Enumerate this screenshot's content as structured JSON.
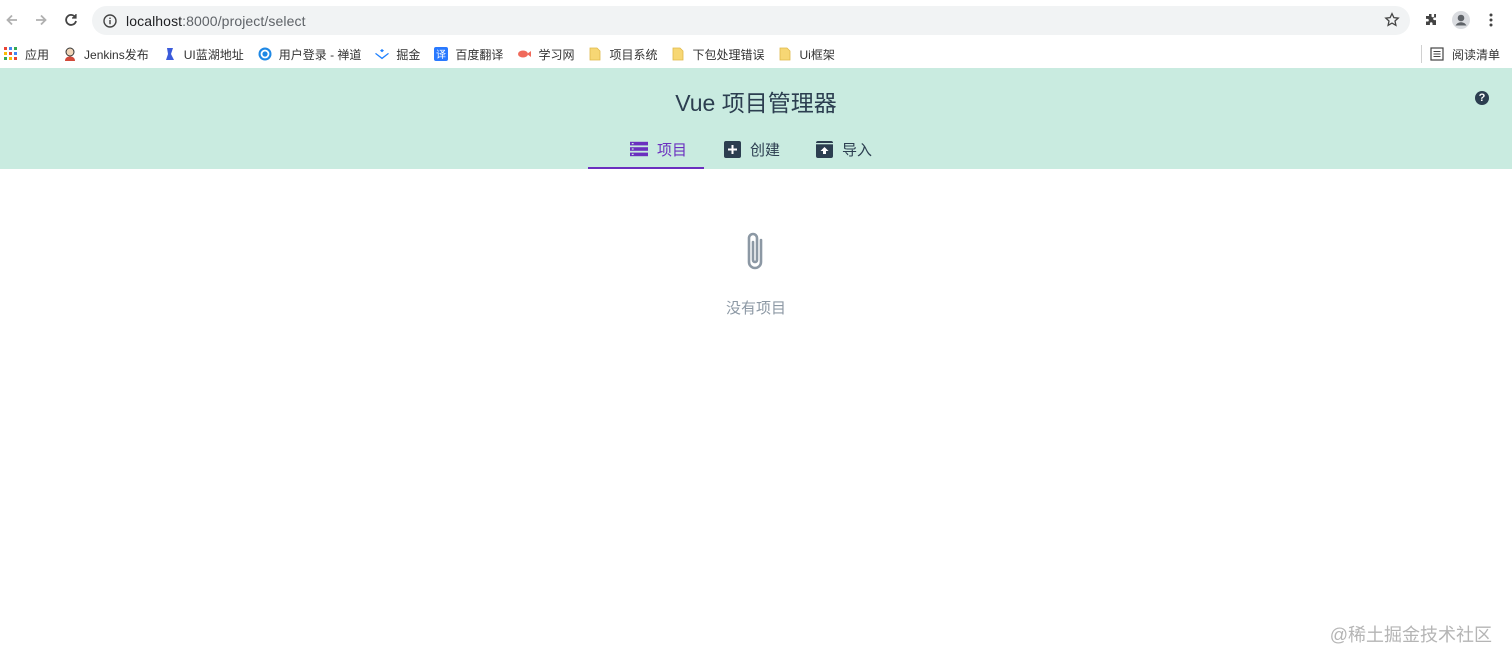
{
  "browser": {
    "url_host": "localhost",
    "url_rest": ":8000/project/select",
    "bookmarks": [
      {
        "label": "应用",
        "icon": "apps-grid-icon",
        "color": "#4285f4"
      },
      {
        "label": "Jenkins发布",
        "icon": "jenkins-icon",
        "color": "#d24939"
      },
      {
        "label": "UI蓝湖地址",
        "icon": "lanhu-icon",
        "color": "#3b5bdb"
      },
      {
        "label": "用户登录 - 禅道",
        "icon": "zentao-icon",
        "color": "#1e88e5"
      },
      {
        "label": "掘金",
        "icon": "juejin-icon",
        "color": "#1e80ff"
      },
      {
        "label": "百度翻译",
        "icon": "baidu-translate-icon",
        "color": "#2979ff"
      },
      {
        "label": "学习网",
        "icon": "fish-icon",
        "color": "#f06a5b"
      },
      {
        "label": "项目系统",
        "icon": "folder-icon",
        "color": "#f7d774"
      },
      {
        "label": "下包处理错误",
        "icon": "folder-icon",
        "color": "#f7d774"
      },
      {
        "label": "Ui框架",
        "icon": "folder-icon",
        "color": "#f7d774"
      }
    ],
    "reading_list": "阅读清单"
  },
  "app": {
    "title": "Vue 项目管理器",
    "help": "?",
    "tabs": [
      {
        "label": "项目",
        "icon": "list-icon",
        "active": true
      },
      {
        "label": "创建",
        "icon": "add-box-icon",
        "active": false
      },
      {
        "label": "导入",
        "icon": "unarchive-icon",
        "active": false
      }
    ],
    "empty_message": "没有项目"
  },
  "watermark": "@稀土掘金技术社区",
  "colors": {
    "header_bg": "#c9ebe0",
    "accent": "#6b2fbf",
    "text": "#2c3e50",
    "muted": "#8c98a4"
  }
}
